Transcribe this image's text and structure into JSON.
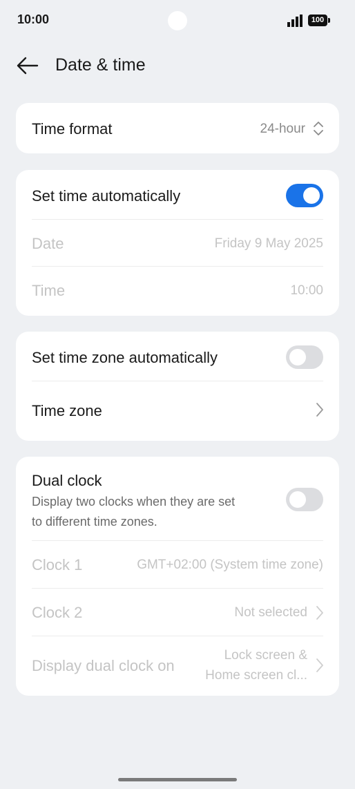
{
  "status_bar": {
    "time": "10:00",
    "battery": "100"
  },
  "header": {
    "title": "Date & time"
  },
  "time_format": {
    "label": "Time format",
    "value": "24-hour"
  },
  "auto_time": {
    "label": "Set time automatically",
    "enabled": true
  },
  "date": {
    "label": "Date",
    "value": "Friday 9 May 2025"
  },
  "time": {
    "label": "Time",
    "value": "10:00"
  },
  "auto_zone": {
    "label": "Set time zone automatically",
    "enabled": false
  },
  "time_zone": {
    "label": "Time zone"
  },
  "dual_clock": {
    "label": "Dual clock",
    "description_line1": "Display two clocks when they are set",
    "description_line2": "to different time zones.",
    "enabled": false
  },
  "clock1": {
    "label": "Clock 1",
    "value": "GMT+02:00 (System time zone)"
  },
  "clock2": {
    "label": "Clock 2",
    "value": "Not selected"
  },
  "display_dual": {
    "label": "Display dual clock on",
    "value_line1": "Lock screen &",
    "value_line2": "Home screen cl..."
  },
  "colors": {
    "accent": "#1a73e8",
    "background": "#eef0f3",
    "card": "#ffffff"
  }
}
